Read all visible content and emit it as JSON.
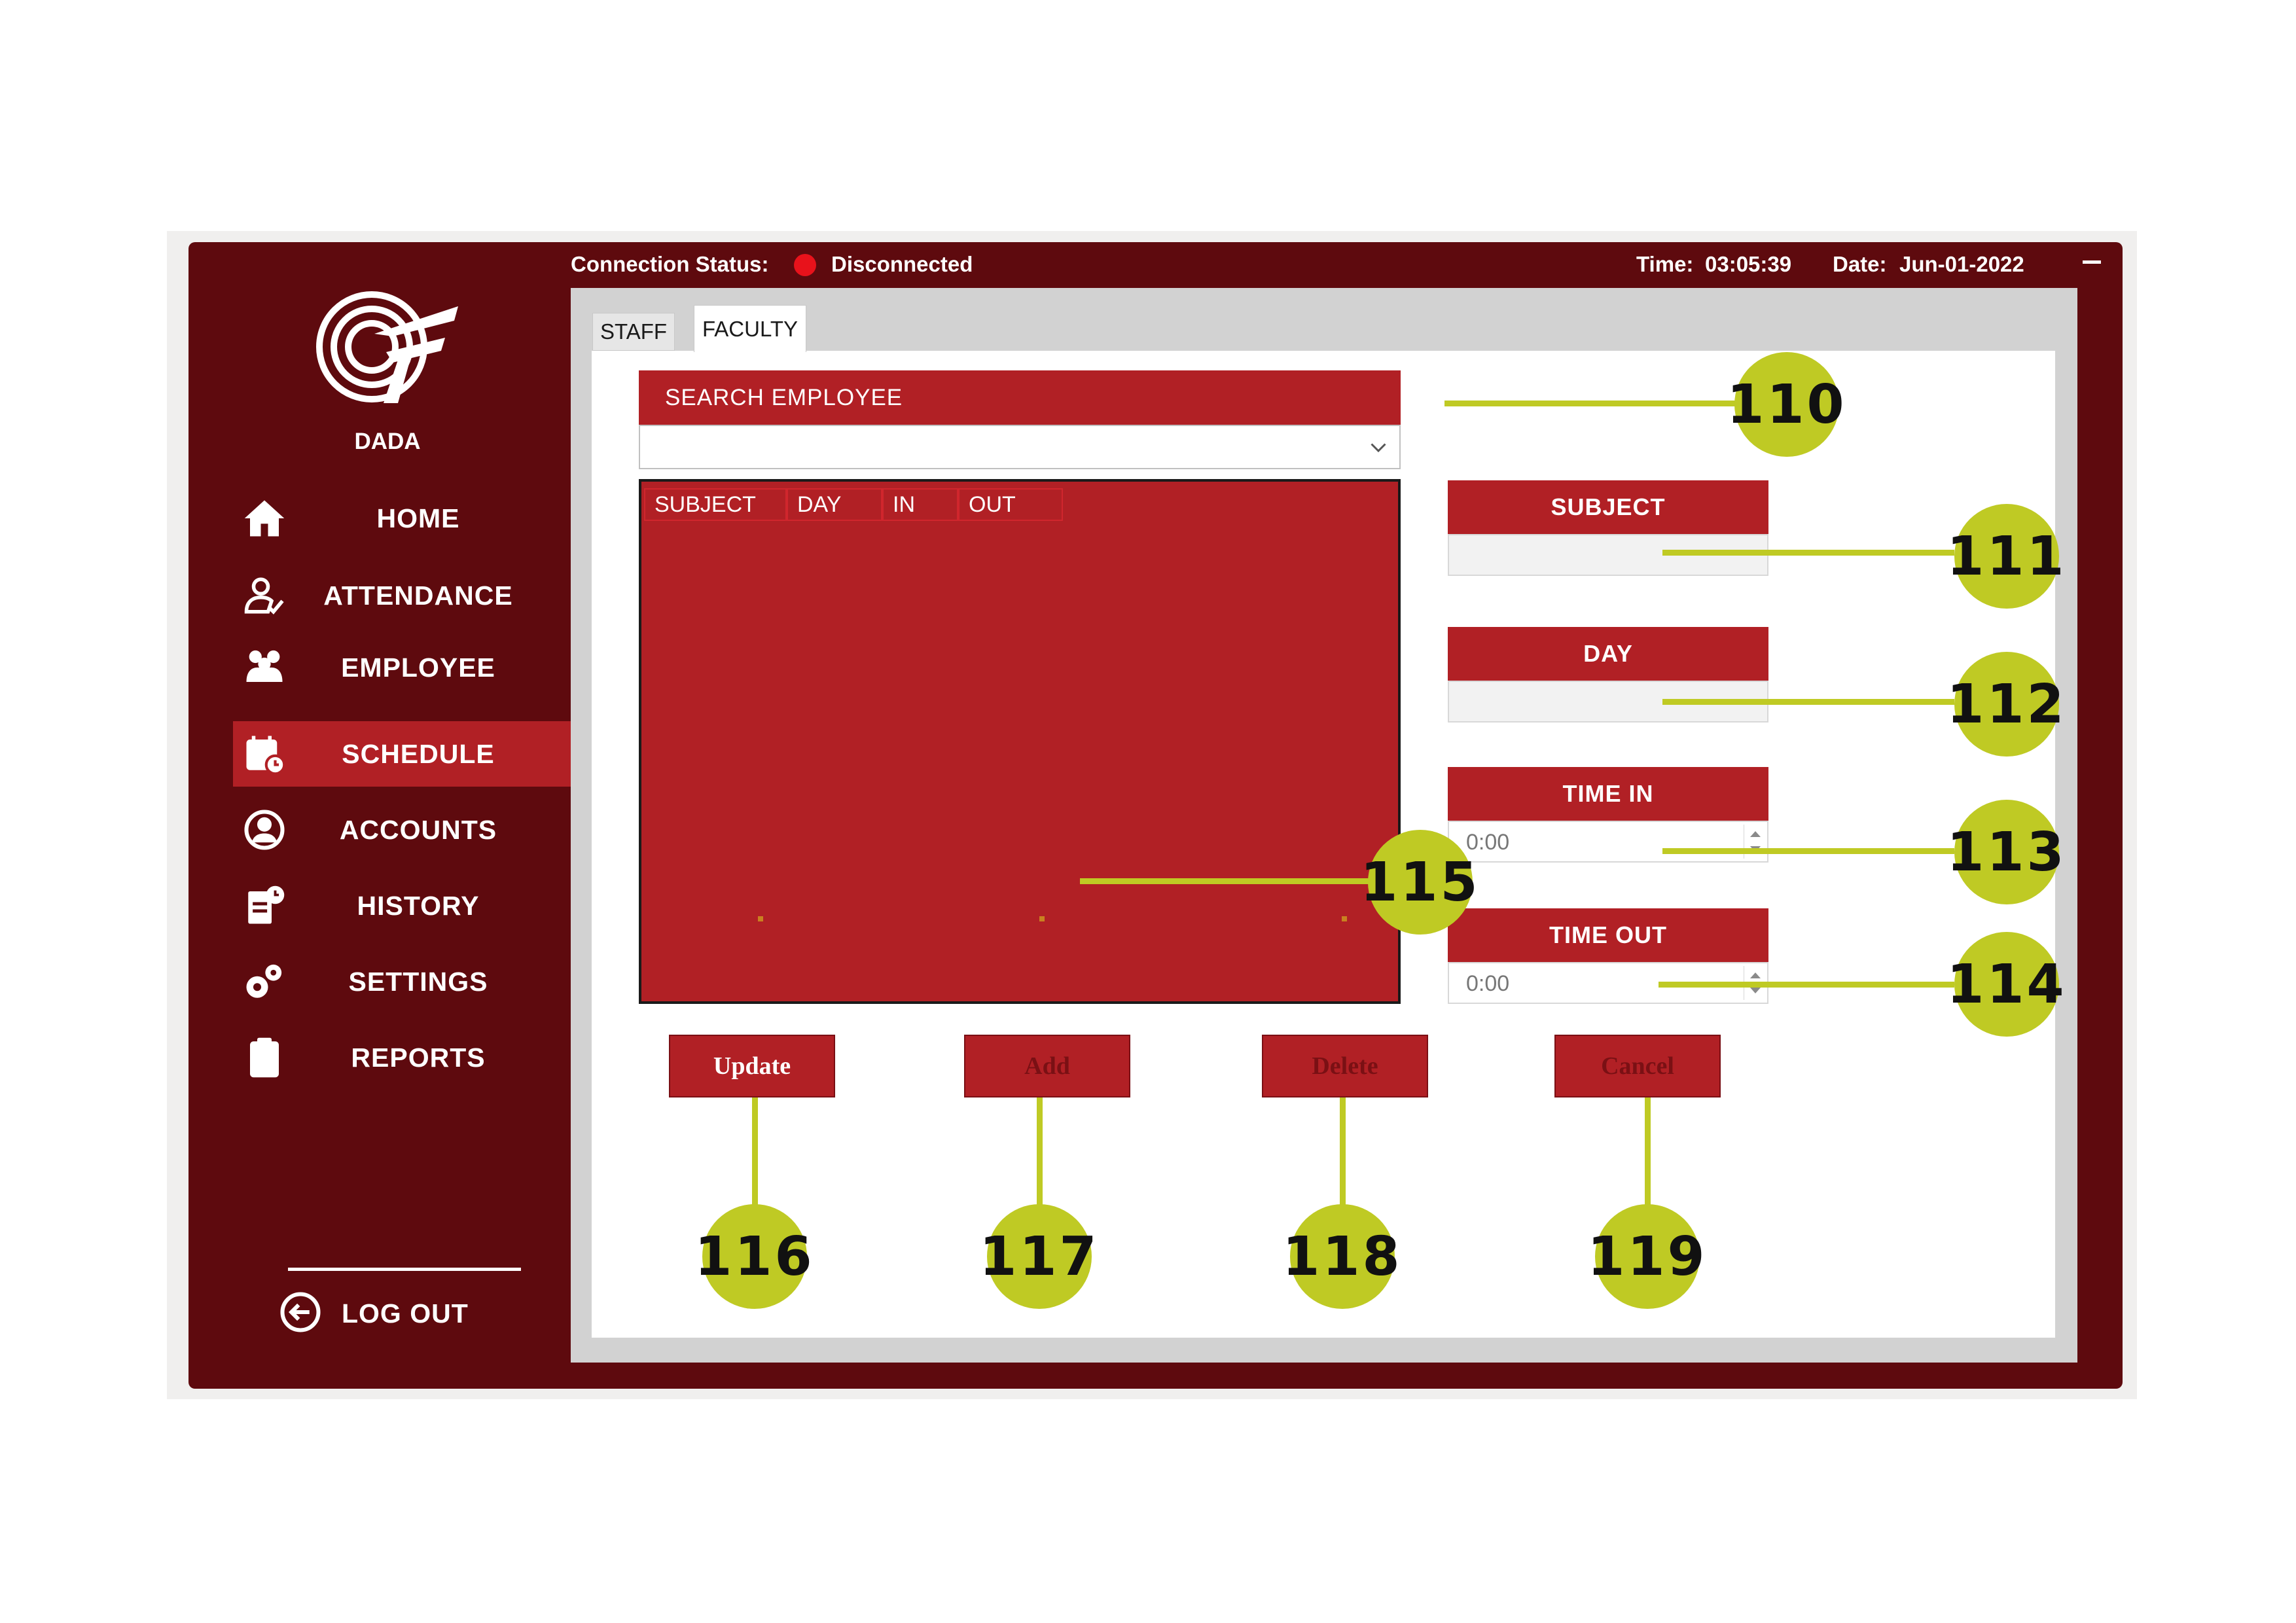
{
  "app": {
    "brand": "DADA",
    "colors": {
      "primary": "#5e0a0e",
      "accent": "#b12025",
      "status_disconnected": "#e8121b",
      "callout": "#bfca24"
    }
  },
  "topbar": {
    "connection_label": "Connection Status:",
    "connection_status": "Disconnected",
    "time_label": "Time:",
    "time": "03:05:39",
    "date_label": "Date:",
    "date": "Jun-01-2022"
  },
  "sidebar": {
    "items": [
      {
        "label": "HOME",
        "icon": "home-icon"
      },
      {
        "label": "ATTENDANCE",
        "icon": "attendance-icon"
      },
      {
        "label": "EMPLOYEE",
        "icon": "employee-icon"
      },
      {
        "label": "SCHEDULE",
        "icon": "schedule-icon",
        "active": true
      },
      {
        "label": "ACCOUNTS",
        "icon": "accounts-icon"
      },
      {
        "label": "HISTORY",
        "icon": "history-icon"
      },
      {
        "label": "SETTINGS",
        "icon": "settings-icon"
      },
      {
        "label": "REPORTS",
        "icon": "reports-icon"
      }
    ],
    "logout": "LOG OUT"
  },
  "tabs": [
    {
      "label": "STAFF"
    },
    {
      "label": "FACULTY",
      "selected": true
    }
  ],
  "search": {
    "header": "SEARCH EMPLOYEE",
    "value": ""
  },
  "grid": {
    "columns": [
      "SUBJECT",
      "DAY",
      "IN",
      "OUT"
    ]
  },
  "form": {
    "subject_label": "SUBJECT",
    "day_label": "DAY",
    "time_in_label": "TIME IN",
    "time_in_value": "0:00",
    "time_out_label": "TIME OUT",
    "time_out_value": "0:00"
  },
  "actions": {
    "update": "Update",
    "add": "Add",
    "delete": "Delete",
    "cancel": "Cancel"
  },
  "callouts": [
    "110",
    "111",
    "112",
    "113",
    "114",
    "115",
    "116",
    "117",
    "118",
    "119"
  ]
}
